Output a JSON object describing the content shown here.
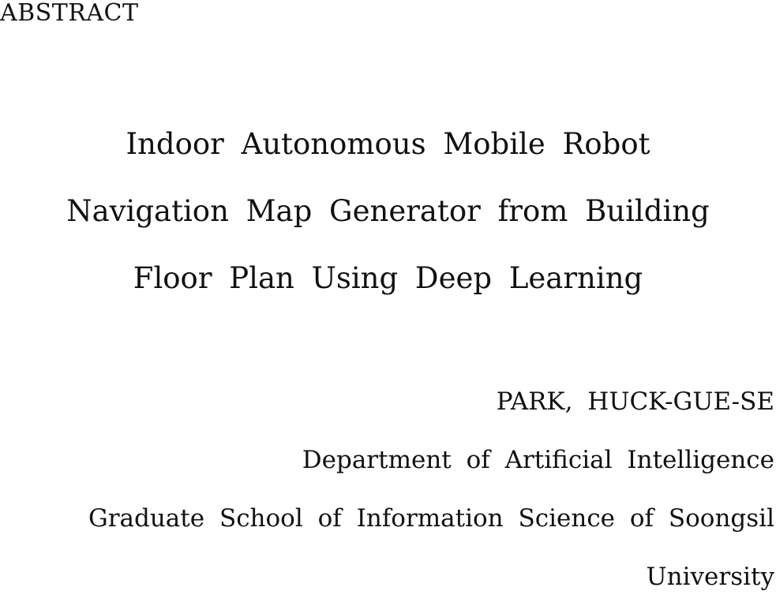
{
  "document": {
    "section_heading": "ABSTRACT",
    "title_lines": [
      "Indoor Autonomous Mobile Robot",
      "Navigation Map Generator from Building",
      "Floor Plan Using Deep Learning"
    ],
    "author": "PARK, HUCK-GUE-SE",
    "affiliation_lines": [
      "Department of Artificial Intelligence",
      "Graduate School of Information Science of Soongsil",
      "University"
    ]
  }
}
